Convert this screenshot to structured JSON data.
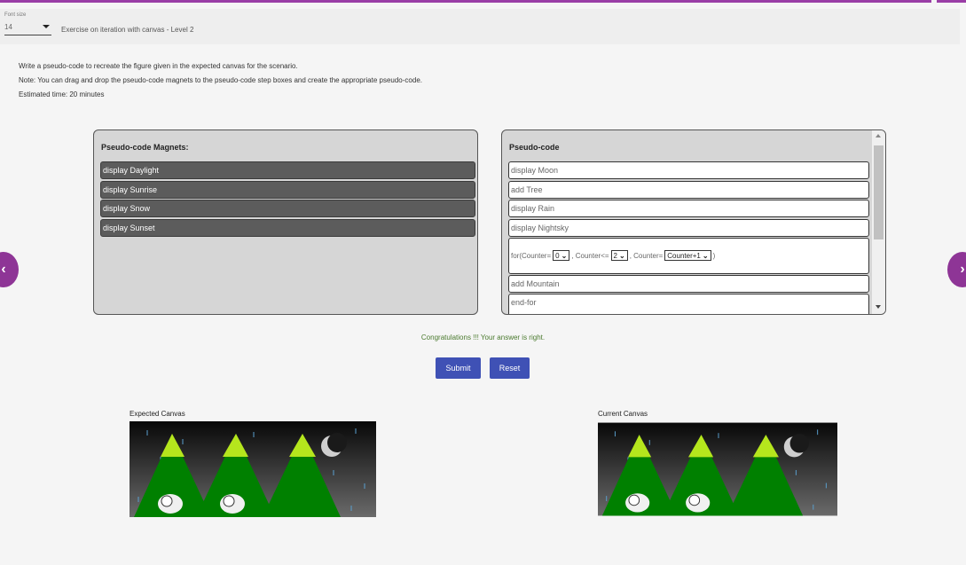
{
  "header": {
    "font_size_label": "Font size",
    "font_size_value": "14",
    "exercise_title": "Exercise on iteration with canvas - Level 2"
  },
  "instructions": {
    "line1": "Write a pseudo-code to recreate the figure given in the expected canvas for the scenario.",
    "line2": "Note: You can drag and drop the pseudo-code magnets to the pseudo-code step boxes and create the appropriate pseudo-code.",
    "line3": "Estimated time: 20 minutes"
  },
  "magnets_panel": {
    "title": "Pseudo-code Magnets:",
    "items": [
      "display Daylight",
      "display Sunrise",
      "display Snow",
      "display Sunset"
    ]
  },
  "pseudocode_panel": {
    "title": "Pseudo-code",
    "steps": [
      "display Moon",
      "add Tree",
      "display Rain",
      "display Nightsky"
    ],
    "for_loop": {
      "prefix": "for(Counter=",
      "init_value": "0",
      "cond_text": ", Counter<=",
      "cond_value": "2",
      "incr_text": ", Counter=",
      "incr_value": "Counter+1",
      "suffix": ")"
    },
    "after_loop": [
      "add Mountain",
      "end-for"
    ]
  },
  "nav": {
    "prev": "‹",
    "next": "›"
  },
  "feedback": "Congratulations !!! Your answer is right.",
  "buttons": {
    "submit": "Submit",
    "reset": "Reset"
  },
  "canvases": {
    "expected_label": "Expected Canvas",
    "current_label": "Current Canvas"
  },
  "colors": {
    "accent": "#8e3596",
    "button": "#3f51b5",
    "success": "#4a7a2e"
  }
}
